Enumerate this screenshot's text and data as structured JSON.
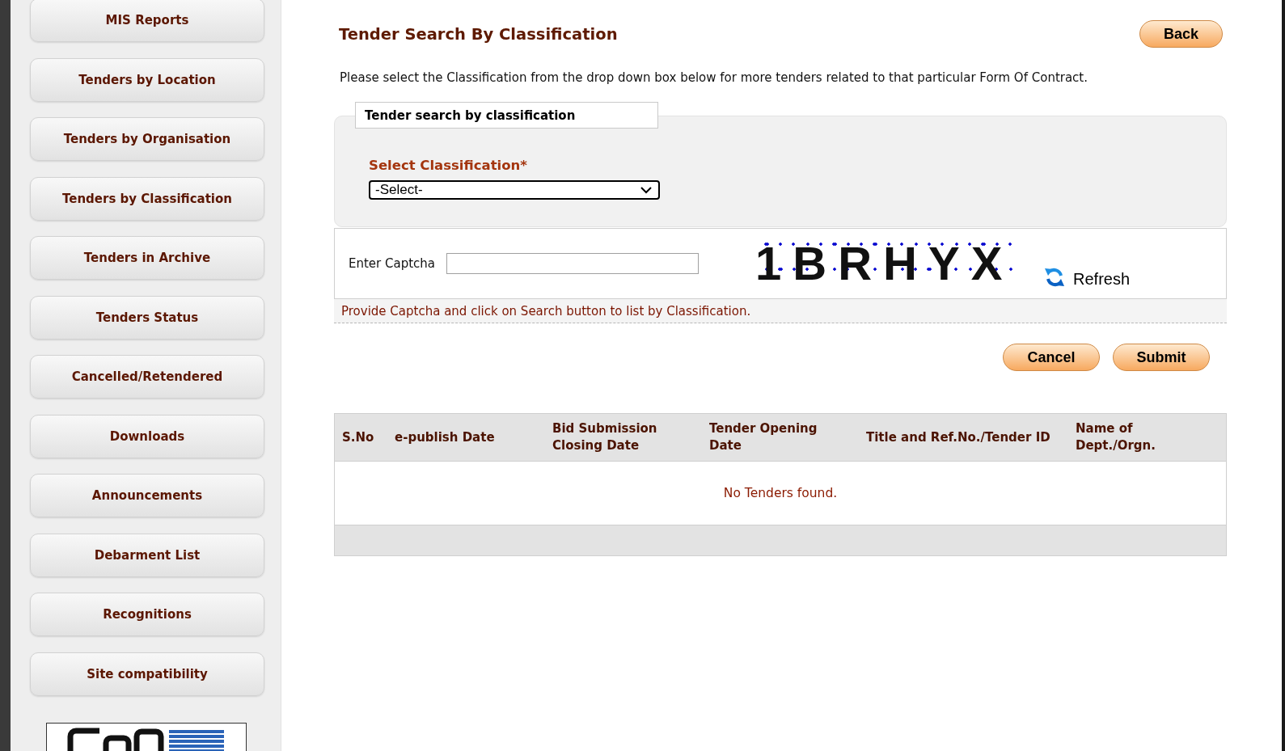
{
  "sidebar": {
    "items": [
      "MIS Reports",
      "Tenders by Location",
      "Tenders by Organisation",
      "Tenders by Classification",
      "Tenders in Archive",
      "Tenders Status",
      "Cancelled/Retendered",
      "Downloads",
      "Announcements",
      "Debarment List",
      "Recognitions",
      "Site compatibility"
    ]
  },
  "header": {
    "title": "Tender Search By Classification",
    "back_button": "Back"
  },
  "instruction": "Please select the Classification from the drop down box below for more tenders related to that particular Form Of Contract.",
  "search_panel": {
    "legend": "Tender search by classification",
    "field_label": "Select Classification*",
    "select": {
      "value": "-Select-"
    }
  },
  "captcha": {
    "label": "Enter Captcha",
    "code": "1BRHYX",
    "refresh": "Refresh"
  },
  "hint": "Provide Captcha and click on Search button to list by Classification.",
  "buttons": [
    {
      "label": "Cancel"
    },
    {
      "label": "Submit"
    }
  ],
  "table": {
    "columns": [
      "S.No",
      "e-publish Date",
      "Bid Submission Closing Date",
      "Tender Opening Date",
      "Title and Ref.No./Tender ID",
      "Name of Dept./Orgn."
    ],
    "empty_message": "No Tenders found."
  }
}
